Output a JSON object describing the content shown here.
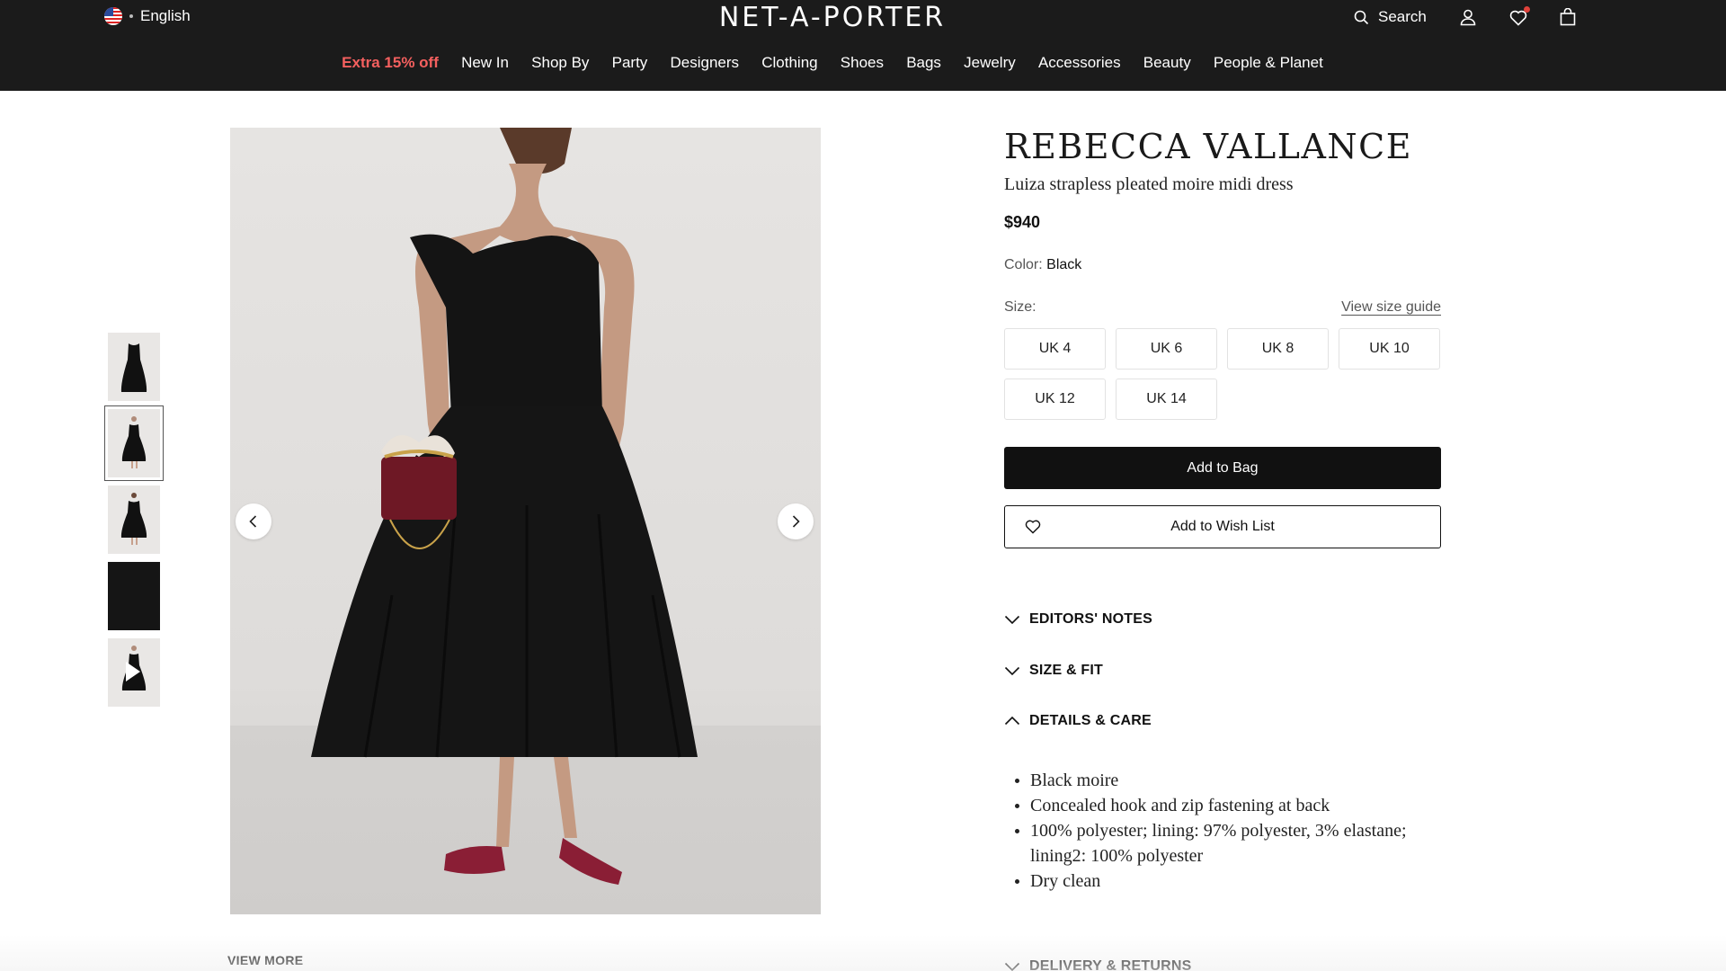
{
  "header": {
    "language": "English",
    "logo": "NET-A-PORTER",
    "search_label": "Search",
    "icons": [
      "flag-us-icon",
      "search-icon",
      "account-icon",
      "wishlist-heart-icon",
      "shopping-bag-icon"
    ]
  },
  "nav": {
    "items": [
      {
        "label": "Extra 15% off",
        "promo": true
      },
      {
        "label": "New In"
      },
      {
        "label": "Shop By"
      },
      {
        "label": "Party"
      },
      {
        "label": "Designers"
      },
      {
        "label": "Clothing"
      },
      {
        "label": "Shoes"
      },
      {
        "label": "Bags"
      },
      {
        "label": "Jewelry"
      },
      {
        "label": "Accessories"
      },
      {
        "label": "Beauty"
      },
      {
        "label": "People & Planet"
      }
    ]
  },
  "gallery": {
    "thumbnails": [
      {
        "name": "thumb-front"
      },
      {
        "name": "thumb-model",
        "active": true
      },
      {
        "name": "thumb-back"
      },
      {
        "name": "thumb-detail"
      },
      {
        "name": "thumb-video",
        "video": true
      }
    ],
    "view_more": "VIEW MORE"
  },
  "product": {
    "brand": "REBECCA VALLANCE",
    "name": "Luiza strapless pleated moire midi dress",
    "price": "$940",
    "color_label": "Color:",
    "color_value": "Black",
    "size_label": "Size:",
    "size_guide": "View size guide",
    "sizes": [
      "UK 4",
      "UK 6",
      "UK 8",
      "UK 10",
      "UK 12",
      "UK 14"
    ],
    "add_to_bag": "Add to Bag",
    "add_to_wishlist": "Add to Wish List"
  },
  "accordions": {
    "editors_notes": "EDITORS' NOTES",
    "size_fit": "SIZE & FIT",
    "details_care": "DETAILS & CARE",
    "delivery_returns": "DELIVERY & RETURNS"
  },
  "details": [
    "Black moire",
    "Concealed hook and zip fastening at back",
    "100% polyester; lining: 97% polyester, 3% elastane; lining2: 100% polyester",
    "Dry clean"
  ],
  "colors": {
    "header_bg": "#1b1b1b",
    "promo": "#f5605f",
    "button_dark": "#111111"
  }
}
